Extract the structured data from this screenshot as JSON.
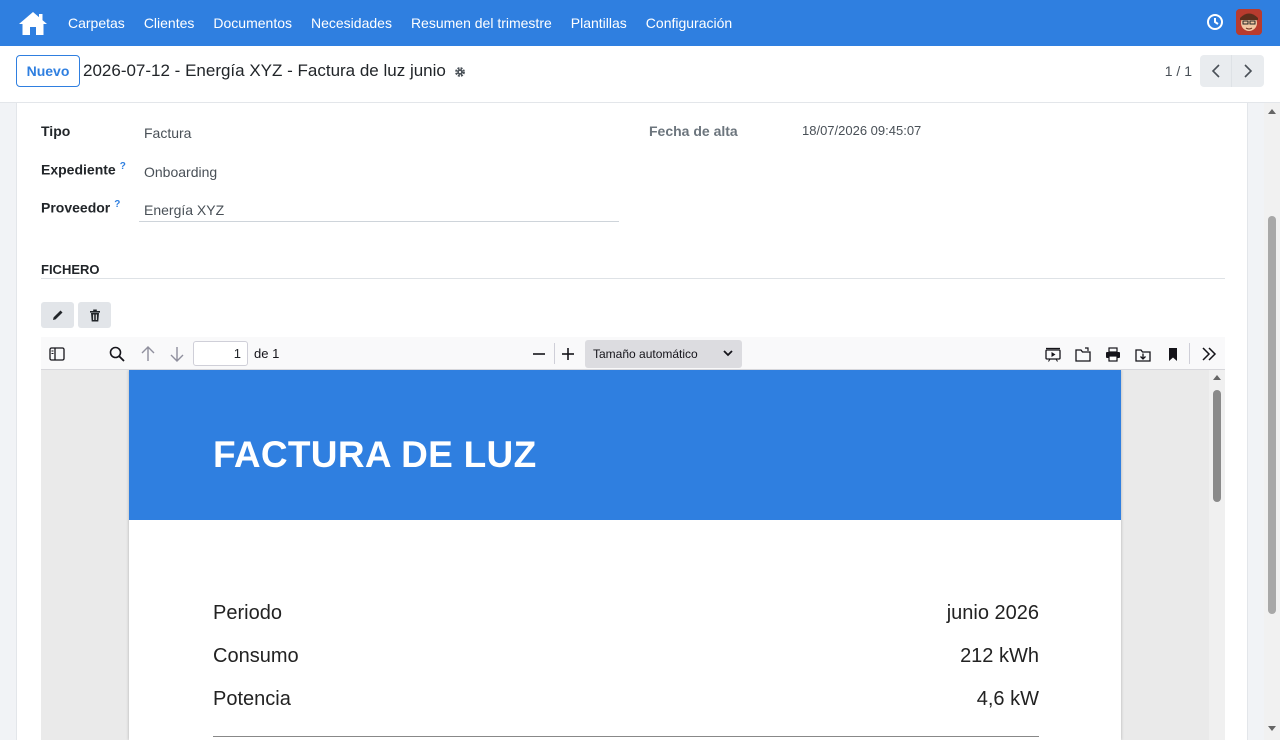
{
  "navbar": {
    "home_icon": "home-icon",
    "items": [
      {
        "label": "Carpetas"
      },
      {
        "label": "Clientes"
      },
      {
        "label": "Documentos"
      },
      {
        "label": "Necesidades"
      },
      {
        "label": "Resumen del trimestre"
      },
      {
        "label": "Plantillas"
      },
      {
        "label": "Configuración"
      }
    ],
    "accent": "#2f7fe0"
  },
  "control": {
    "new_label": "Nuevo",
    "record_title": "2026-07-12 - Energía XYZ - Factura de luz junio",
    "pager": "1 / 1"
  },
  "form": {
    "tipo_label": "Tipo",
    "tipo_value": "Factura",
    "expediente_label": "Expediente",
    "expediente_value": "Onboarding",
    "proveedor_label": "Proveedor",
    "proveedor_value": "Energía XYZ",
    "help_mark": "?",
    "fecha_alta_label": "Fecha de alta",
    "fecha_alta_value": "18/07/2026 09:45:07",
    "section_title": "FICHERO"
  },
  "pdf_viewer": {
    "page_number": "1",
    "page_of": "de 1",
    "zoom": "Tamaño automático"
  },
  "pdf": {
    "title": "FACTURA DE LUZ",
    "rows": [
      {
        "key": "Periodo",
        "value": "junio 2026"
      },
      {
        "key": "Consumo",
        "value": "212 kWh"
      },
      {
        "key": "Potencia",
        "value": "4,6 kW"
      }
    ]
  }
}
